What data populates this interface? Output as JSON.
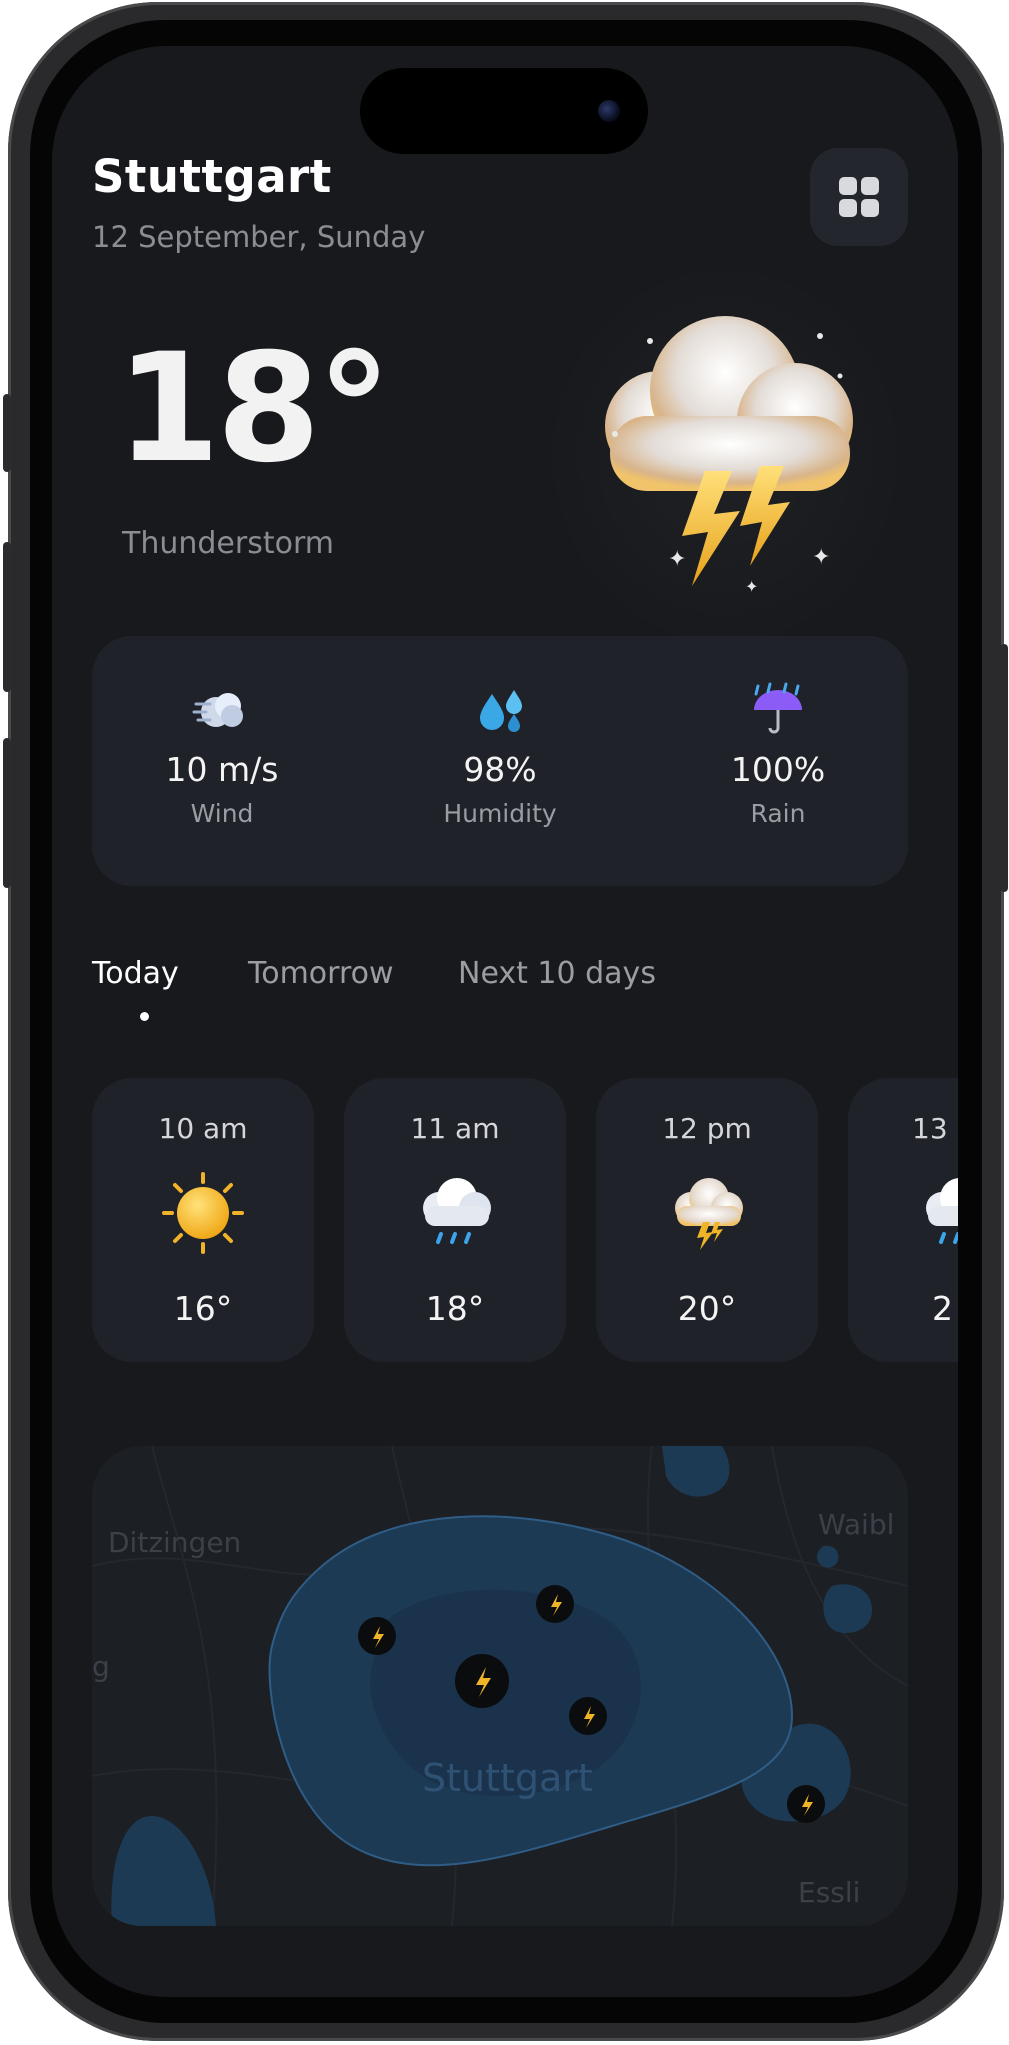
{
  "header": {
    "city": "Stuttgart",
    "date": "12 September, Sunday",
    "menu_icon": "grid-icon"
  },
  "current": {
    "temperature": "18°",
    "condition": "Thunderstorm",
    "icon": "thunderstorm-cloud-icon"
  },
  "stats": [
    {
      "value": "10 m/s",
      "label": "Wind",
      "icon": "wind-icon"
    },
    {
      "value": "98%",
      "label": "Humidity",
      "icon": "droplets-icon"
    },
    {
      "value": "100%",
      "label": "Rain",
      "icon": "umbrella-rain-icon"
    }
  ],
  "tabs": [
    {
      "label": "Today",
      "active": true
    },
    {
      "label": "Tomorrow",
      "active": false
    },
    {
      "label": "Next 10 days",
      "active": false
    }
  ],
  "hourly": [
    {
      "time": "10 am",
      "temp": "16°",
      "icon": "sun-icon"
    },
    {
      "time": "11 am",
      "temp": "18°",
      "icon": "rain-cloud-icon"
    },
    {
      "time": "12 pm",
      "temp": "20°",
      "icon": "storm-cloud-icon"
    },
    {
      "time": "13",
      "temp": "2",
      "icon": "rain-cloud-icon"
    }
  ],
  "map": {
    "labels": [
      "Ditzingen",
      "Waibl",
      "Stuttgart",
      "g",
      "Essli"
    ],
    "colors": {
      "storm_area": "#1d3a55",
      "storm_core": "#1a324b",
      "marker": "#0b0c0e",
      "bolt": "#f0b429"
    }
  },
  "colors": {
    "background": "#17191d",
    "card": "#1f2228",
    "text": "#ffffff",
    "muted": "#8a8d93"
  }
}
